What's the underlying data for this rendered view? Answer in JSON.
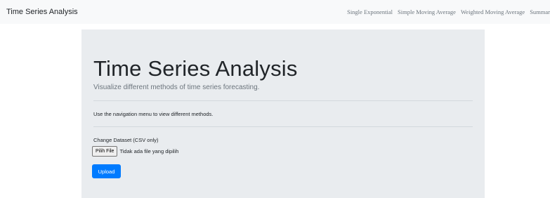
{
  "navbar": {
    "brand": "Time Series Analysis",
    "links": [
      {
        "label": "Single Exponential"
      },
      {
        "label": "Simple Moving Average"
      },
      {
        "label": "Weighted Moving Average"
      },
      {
        "label": "Summar"
      }
    ]
  },
  "jumbotron": {
    "title": "Time Series Analysis",
    "lead": "Visualize different methods of time series forecasting.",
    "info": "Use the navigation menu to view different methods.",
    "upload_form": {
      "label": "Change Dataset (CSV only)",
      "file_button": "Pilih File",
      "file_status": "Tidak ada file yang dipilih",
      "submit": "Upload"
    }
  },
  "colors": {
    "navbar_bg": "#f8f9fa",
    "jumbotron_bg": "#e9ecef",
    "primary": "#007bff",
    "muted": "#6c757d"
  }
}
